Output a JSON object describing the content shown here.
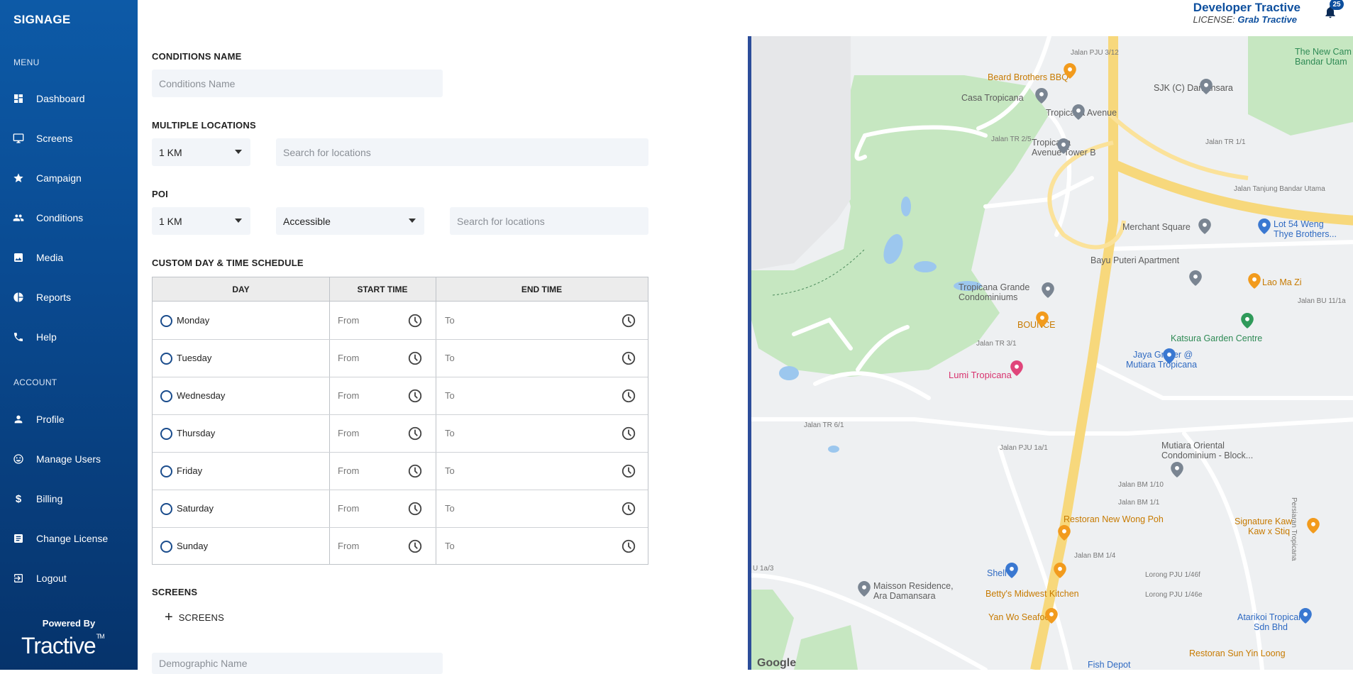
{
  "app": {
    "brand": "SIGNAGE"
  },
  "sidebar": {
    "menu_label": "MENU",
    "account_label": "ACCOUNT",
    "items": [
      {
        "label": "Dashboard",
        "icon": "dashboard-icon"
      },
      {
        "label": "Screens",
        "icon": "monitor-icon"
      },
      {
        "label": "Campaign",
        "icon": "star-icon"
      },
      {
        "label": "Conditions",
        "icon": "people-icon"
      },
      {
        "label": "Media",
        "icon": "image-icon"
      },
      {
        "label": "Reports",
        "icon": "pie-chart-icon"
      },
      {
        "label": "Help",
        "icon": "phone-icon"
      }
    ],
    "account_items": [
      {
        "label": "Profile",
        "icon": "person-icon"
      },
      {
        "label": "Manage Users",
        "icon": "smiley-icon"
      },
      {
        "label": "Billing",
        "icon": "dollar-icon"
      },
      {
        "label": "Change License",
        "icon": "license-icon"
      },
      {
        "label": "Logout",
        "icon": "logout-icon"
      }
    ],
    "powered_by": "Powered By",
    "logo_text": "Tractive",
    "logo_tm": "TM"
  },
  "header": {
    "user_name": "Developer Tractive",
    "license_label": "LICENSE:",
    "license_value": "Grab Tractive",
    "notification_count": "25"
  },
  "form": {
    "conditions_name": {
      "label": "CONDITIONS NAME",
      "placeholder": "Conditions Name",
      "value": ""
    },
    "multiple_locations": {
      "label": "MULTIPLE LOCATIONS",
      "radius": "1 KM",
      "search_placeholder": "Search for locations"
    },
    "poi": {
      "label": "POI",
      "radius": "1 KM",
      "accessibility": "Accessible",
      "search_placeholder": "Search for locations"
    },
    "schedule": {
      "label": "CUSTOM DAY & TIME SCHEDULE",
      "headers": {
        "day": "DAY",
        "start": "START TIME",
        "end": "END TIME"
      },
      "from_placeholder": "From",
      "to_placeholder": "To",
      "days": [
        "Monday",
        "Tuesday",
        "Wednesday",
        "Thursday",
        "Friday",
        "Saturday",
        "Sunday"
      ]
    },
    "screens": {
      "label": "SCREENS",
      "add_button": "SCREENS"
    },
    "demographic": {
      "placeholder": "Demographic Name"
    }
  },
  "map": {
    "labels": {
      "pju312": "Jalan PJU 3/12",
      "beard": "Beard Brothers BBQ",
      "casa": "Casa Tropicana",
      "trop_ave": "Tropicana Avenue",
      "trop_tower1": "Tropicana",
      "trop_tower2": "Avenue Tower B",
      "sjk": "SJK (C) Damansara",
      "newcam1": "The New Cam",
      "newcam2": "Bandar Utam",
      "jtr25": "Jalan TR 2/5",
      "jtr11": "Jalan TR 1/1",
      "merchant": "Merchant Square",
      "lot54a": "Lot 54 Weng",
      "lot54b": "Thye Brothers...",
      "bayu": "Bayu Puteri Apartment",
      "laomazi": "Lao Ma Zi",
      "grande1": "Tropicana Grande",
      "grande2": "Condominiums",
      "bounce": "BOUNCE",
      "katsura": "Katsura Garden Centre",
      "jaya1": "Jaya Grocer @",
      "jaya2": "Mutiara Tropicana",
      "lumi": "Lumi Tropicana",
      "jtr31": "Jalan TR 3/1",
      "mutiara1": "Mutiara Oriental",
      "mutiara2": "Condominium - Block...",
      "persiaran": "Persiaran Tropicana",
      "wongpoh": "Restoran New Wong Poh",
      "signature1": "Signature Kaw",
      "signature2": "Kaw x Stiq",
      "shell": "Shell",
      "maisson1": "Maisson Residence,",
      "maisson2": "Ara Damansara",
      "bettys": "Betty's Midwest Kitchen",
      "atarikoi1": "Atarikoi Tropicana",
      "atarikoi2": "Sdn Bhd",
      "yanwo": "Yan Wo Seafood",
      "sunyin": "Restoran Sun Yin Loong",
      "fishdepot": "Fish Depot",
      "jpju1a1": "Jalan PJU 1a/1",
      "jalanbu11": "Jalan BU 11/1a",
      "jbm110": "Jalan BM 1/10",
      "jbm11": "Jalan BM 1/1",
      "jbm14": "Jalan BM 1/4",
      "lorong46f": "Lorong PJU 1/46f",
      "lorong46e": "Lorong PJU 1/46e",
      "jtr61": "Jalan TR 6/1",
      "tanjung": "Jalan Tanjung Bandar Utama",
      "u13": "U 1a/3",
      "google": "Google"
    }
  }
}
